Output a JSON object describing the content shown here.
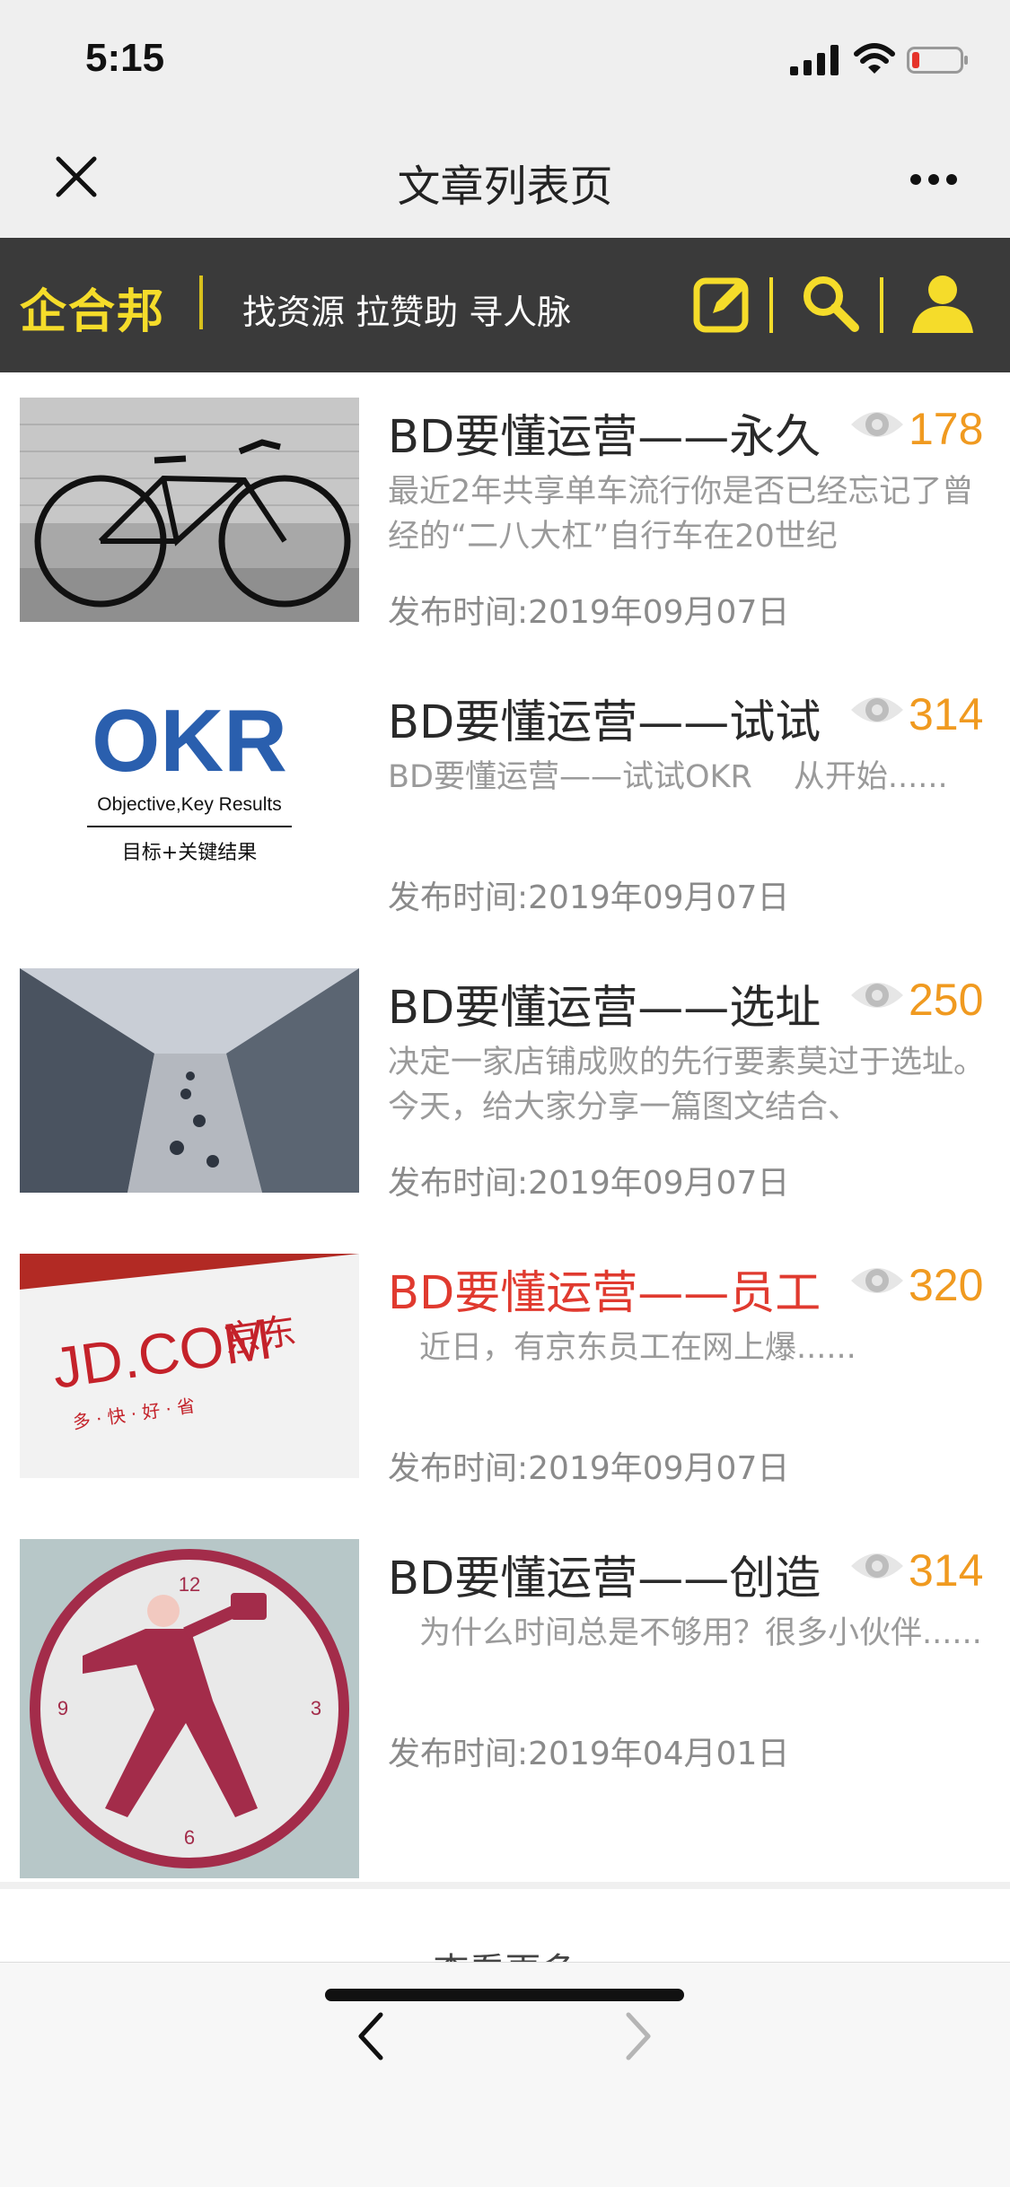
{
  "status_bar": {
    "time": "5:15"
  },
  "nav": {
    "title": "文章列表页"
  },
  "site_header": {
    "logo": "企合邦",
    "tagline": "找资源 拉赞助 寻人脉",
    "brand_color": "#f5dc2a"
  },
  "articles": [
    {
      "title": "BD要懂运营——永久",
      "views": "178",
      "summary": "最近2年共享单车流行你是否已经忘记了曾经的“二八大杠”自行车在20世纪",
      "date": "发布时间:2019年09月07日",
      "thumb": "bicycle"
    },
    {
      "title": "BD要懂运营——试试",
      "views": "314",
      "summary": "BD要懂运营——试试OKR　 从开始......",
      "date": "发布时间:2019年09月07日",
      "thumb": "okr",
      "thumb_text": {
        "main": "OKR",
        "sub": "Objective,Key Results",
        "cn": "目标+关键结果"
      }
    },
    {
      "title": "BD要懂运营——选址",
      "views": "250",
      "summary": "决定一家店铺成败的先行要素莫过于选址。今天，给大家分享一篇图文结合、",
      "date": "发布时间:2019年09月07日",
      "thumb": "mall"
    },
    {
      "title": "BD要懂运营——员工",
      "views": "320",
      "summary": "　近日，有京东员工在网上爆......",
      "date": "发布时间:2019年09月07日",
      "thumb": "jd",
      "title_color": "#e03a2f",
      "thumb_text": {
        "main": "JD.COM",
        "cn": "京东",
        "sub": "多 · 快 · 好 · 省"
      }
    },
    {
      "title": "BD要懂运营——创造",
      "views": "314",
      "summary": "　为什么时间总是不够用？很多小伙伴......",
      "date": "发布时间:2019年04月01日",
      "thumb": "clock",
      "thumb_text": {
        "n12": "12",
        "n3": "3",
        "n6": "6",
        "n9": "9"
      }
    }
  ],
  "load_more": "查看更多",
  "colors": {
    "views": "#f09a20",
    "header_bg": "#3a3a3a",
    "highlight_title": "#e03a2f"
  }
}
